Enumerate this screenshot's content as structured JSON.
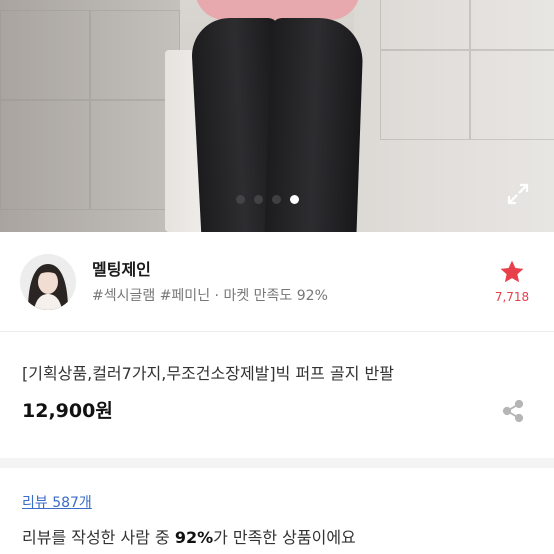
{
  "product_gallery": {
    "slide_count": 4,
    "active_slide": 4,
    "expand_icon": "expand-arrows-icon"
  },
  "seller": {
    "name": "멜팅제인",
    "tags": "#섹시글램 #페미닌",
    "separator": " · ",
    "satisfaction_label": "마켓 만족도",
    "satisfaction_value": "92%",
    "favorite_icon": "star-icon",
    "favorite_count": "7,718",
    "accent_color": "#e8404a"
  },
  "product": {
    "title": "[기획상품,컬러7가지,무조건소장제발]빅 퍼프 골지 반팔",
    "price": "12,900원",
    "share_icon": "share-icon"
  },
  "reviews": {
    "link_label": "리뷰 587개",
    "summary_prefix": "리뷰를 작성한 사람 중 ",
    "summary_highlight": "92%",
    "summary_suffix": "가 만족한 상품이에요"
  }
}
